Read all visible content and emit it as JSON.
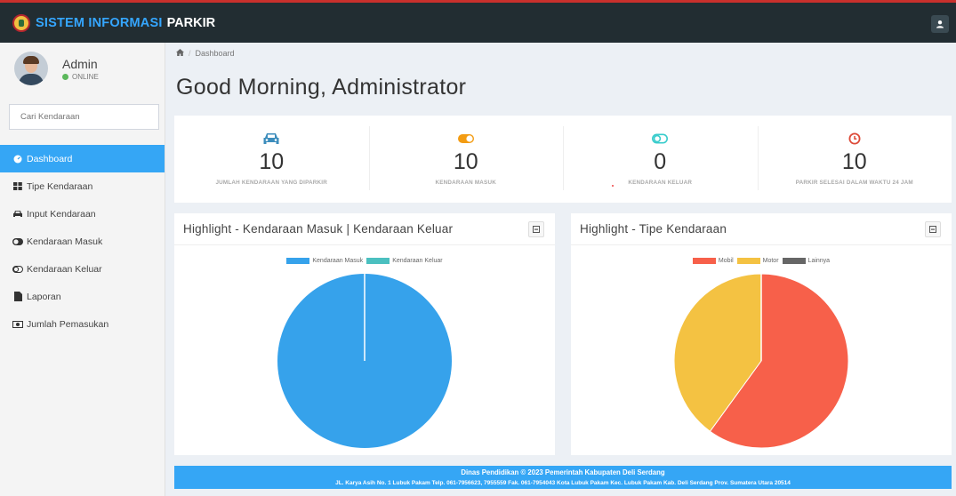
{
  "header": {
    "brand_primary": "SISTEM INFORMASI",
    "brand_secondary": "PARKIR"
  },
  "sidebar": {
    "user_name": "Admin",
    "user_status": "ONLINE",
    "search_placeholder": "Cari Kendaraan",
    "items": [
      {
        "label": "Dashboard",
        "icon": "dashboard-icon",
        "active": true
      },
      {
        "label": "Tipe Kendaraan",
        "icon": "grid-icon",
        "active": false
      },
      {
        "label": "Input Kendaraan",
        "icon": "car-icon",
        "active": false
      },
      {
        "label": "Kendaraan Masuk",
        "icon": "toggle-on-icon",
        "active": false
      },
      {
        "label": "Kendaraan Keluar",
        "icon": "toggle-off-icon",
        "active": false
      },
      {
        "label": "Laporan",
        "icon": "file-icon",
        "active": false
      },
      {
        "label": "Jumlah Pemasukan",
        "icon": "money-icon",
        "active": false
      }
    ]
  },
  "breadcrumb": {
    "home_icon": "home-icon",
    "current": "Dashboard"
  },
  "page_title": "Good Morning, Administrator",
  "stats": [
    {
      "value": "10",
      "label": "JUMLAH KENDARAAN YANG DIPARKIR",
      "icon": "car-icon",
      "color": "#3c8dbc"
    },
    {
      "value": "10",
      "label": "KENDARAAN MASUK",
      "icon": "toggle-on-icon",
      "color": "#f39c12"
    },
    {
      "value": "0",
      "label": "KENDARAAN KELUAR",
      "icon": "toggle-off-icon",
      "color": "#39cccc"
    },
    {
      "value": "10",
      "label": "PARKIR SELESAI DALAM WAKTU 24 JAM",
      "icon": "clock-icon",
      "color": "#dd4b39"
    }
  ],
  "panels": {
    "left_title": "Highlight - Kendaraan Masuk | Kendaraan Keluar",
    "right_title": "Highlight - Tipe Kendaraan"
  },
  "chart_data": [
    {
      "type": "pie",
      "categories": [
        "Kendaraan Masuk",
        "Kendaraan Keluar"
      ],
      "values": [
        10,
        0
      ],
      "colors": [
        "#36a2eb",
        "#4bc0c0"
      ],
      "legend": "top"
    },
    {
      "type": "pie",
      "categories": [
        "Mobil",
        "Motor",
        "Lainnya"
      ],
      "values": [
        6,
        4,
        0
      ],
      "colors": [
        "#f7604a",
        "#f4c242",
        "#666666"
      ],
      "legend": "top"
    }
  ],
  "footer": {
    "line1": "Dinas Pendidikan © 2023 Pemerintah Kabupaten Deli Serdang",
    "line2": "JL. Karya Asih No. 1 Lubuk Pakam Telp. 061-7956623, 7955559 Fak. 061-7954043 Kota Lubuk Pakam Kec. Lubuk Pakam Kab. Deli Serdang Prov. Sumatera Utara 20514"
  }
}
